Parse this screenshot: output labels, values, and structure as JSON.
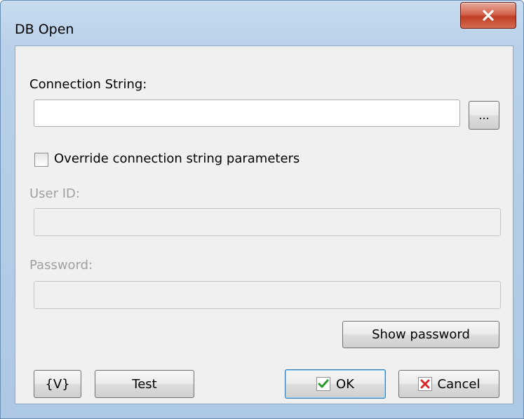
{
  "window": {
    "title": "DB Open"
  },
  "form": {
    "connection_string_label": "Connection String:",
    "connection_string_value": "",
    "browse_label": "...",
    "override_label": "Override connection string parameters",
    "override_checked": false,
    "user_id_label": "User ID:",
    "user_id_value": "",
    "password_label": "Password:",
    "password_value": "",
    "show_password_label": "Show password"
  },
  "footer": {
    "variables_label": "{V}",
    "test_label": "Test",
    "ok_label": "OK",
    "cancel_label": "Cancel"
  },
  "icons": {
    "close": "close-icon",
    "ok": "checkmark-icon",
    "cancel": "x-icon"
  },
  "colors": {
    "ok_check": "#2a9a2a",
    "cancel_x": "#d8282a",
    "close_bg": "#c9462c"
  }
}
